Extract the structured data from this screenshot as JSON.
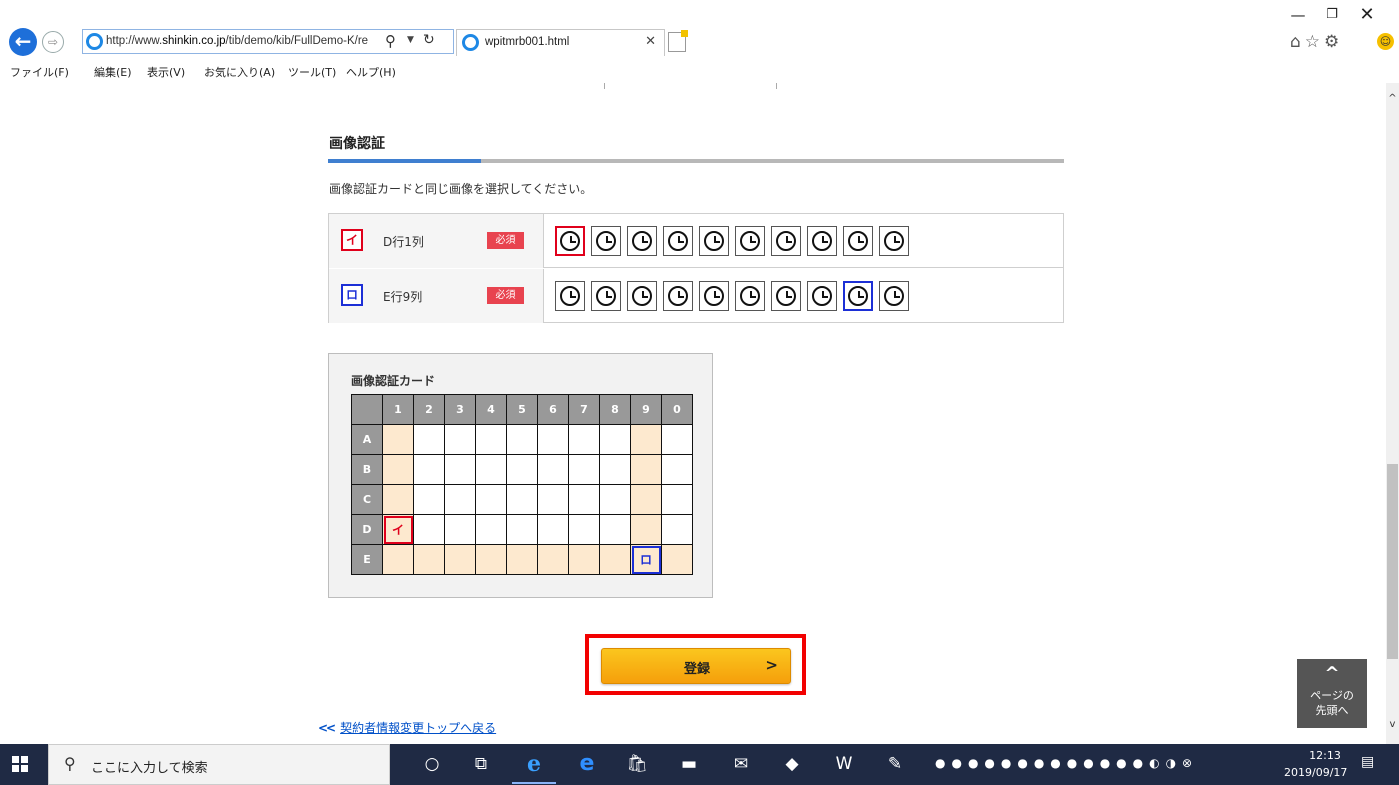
{
  "browser": {
    "url_prefix": "http://www.",
    "url_host": "shinkin.co.jp",
    "url_path": "/tib/demo/kib/FullDemo-K/re",
    "tab_title": "wpitmrb001.html",
    "menu": [
      "ファイル(F)",
      "編集(E)",
      "表示(V)",
      "お気に入り(A)",
      "ツール(T)",
      "ヘルプ(H)"
    ]
  },
  "page": {
    "section_title": "画像認証",
    "instructions": "画像認証カードと同じ画像を選択してください。",
    "rows": [
      {
        "kana": "イ",
        "position": "D行1列",
        "required": "必須",
        "selected_index": 0,
        "color": "#e0001b"
      },
      {
        "kana": "ロ",
        "position": "E行9列",
        "required": "必須",
        "selected_index": 8,
        "color": "#1c2fd6"
      }
    ],
    "card": {
      "title": "画像認証カード",
      "cols": [
        "1",
        "2",
        "3",
        "4",
        "5",
        "6",
        "7",
        "8",
        "9",
        "0"
      ],
      "rows": [
        "A",
        "B",
        "C",
        "D",
        "E"
      ],
      "marks": [
        {
          "row": "D",
          "col": "1",
          "kana": "イ"
        },
        {
          "row": "E",
          "col": "9",
          "kana": "ロ"
        }
      ]
    },
    "register_label": "登録",
    "back_link": "契約者情報変更トップへ戻る",
    "page_top_1": "ページの",
    "page_top_2": "先頭へ"
  },
  "taskbar": {
    "search_placeholder": "ここに入力して検索",
    "time": "12:13",
    "date": "2019/09/17"
  }
}
